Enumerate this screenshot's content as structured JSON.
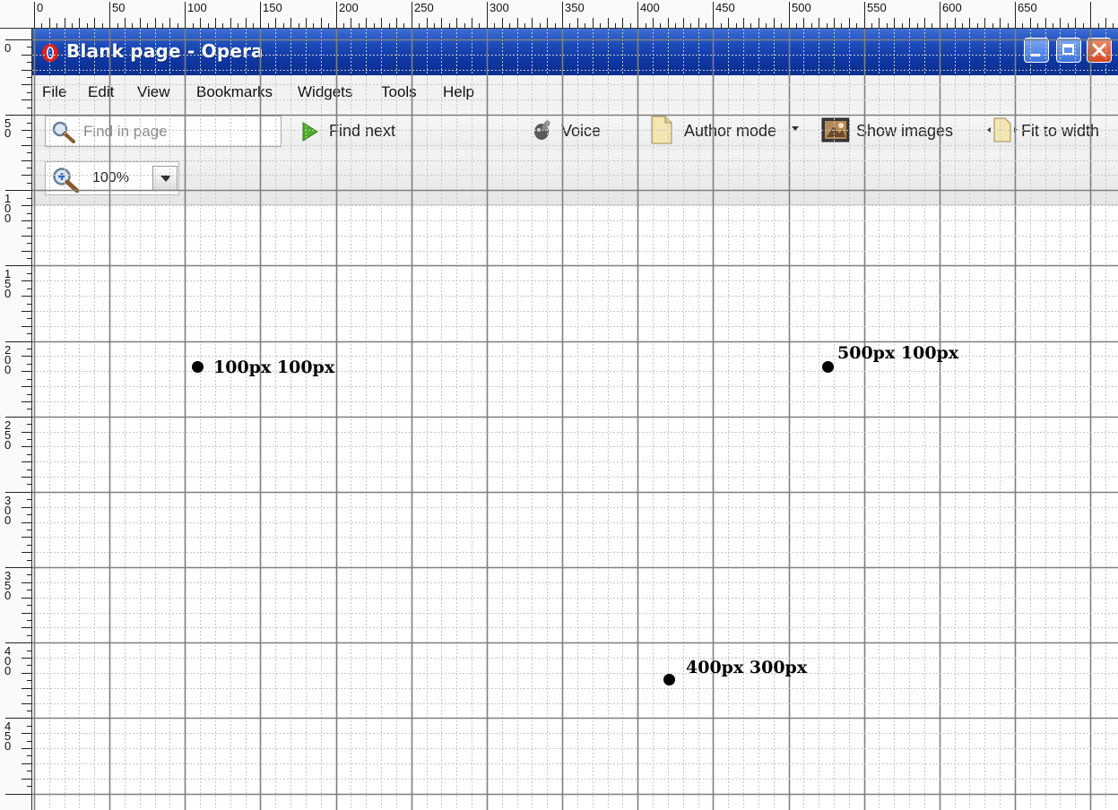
{
  "ruler": {
    "horizontal_labels": [
      "0",
      "50",
      "100",
      "150",
      "200",
      "250",
      "300",
      "350",
      "400",
      "450",
      "500",
      "550",
      "600",
      "650"
    ],
    "vertical_labels": [
      "0",
      "50",
      "100",
      "150",
      "200",
      "250",
      "300",
      "350",
      "400",
      "450"
    ]
  },
  "window": {
    "title": "Blank page - Opera"
  },
  "menu": {
    "file": "File",
    "edit": "Edit",
    "view": "View",
    "bookmarks": "Bookmarks",
    "widgets": "Widgets",
    "tools": "Tools",
    "help": "Help"
  },
  "toolbar": {
    "find_placeholder": "Find in page",
    "find_next": "Find next",
    "voice": "Voice",
    "author_mode": "Author mode",
    "show_images": "Show images",
    "fit_to_width": "Fit to width"
  },
  "zoom": {
    "value": "100%"
  },
  "markers": [
    {
      "label": "100px 100px"
    },
    {
      "label": "500px 100px"
    },
    {
      "label": "400px 300px"
    }
  ],
  "icons": [
    "opera-logo-icon",
    "minimize-icon",
    "maximize-icon",
    "close-icon",
    "search-icon",
    "play-arrow-icon",
    "voice-icon",
    "document-icon",
    "dropdown-arrow-icon",
    "image-icon",
    "fit-to-width-icon",
    "zoom-icon"
  ]
}
